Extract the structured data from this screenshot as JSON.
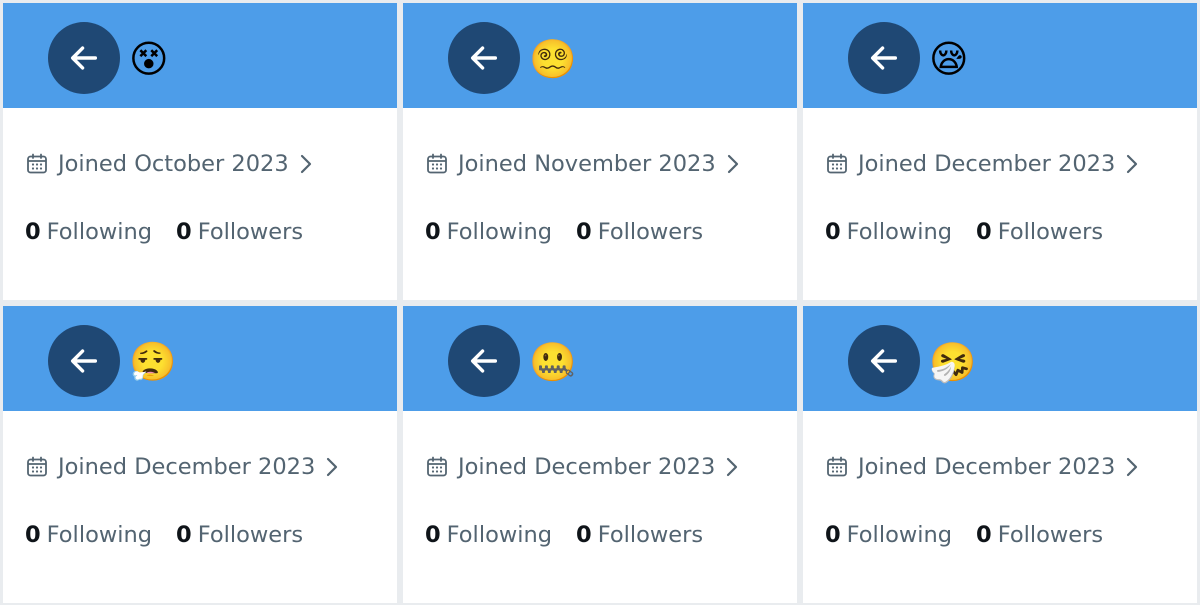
{
  "cards": [
    {
      "emoji": "😵",
      "joined": "Joined October 2023",
      "following_count": "0",
      "following_label": "Following",
      "followers_count": "0",
      "followers_label": "Followers"
    },
    {
      "emoji": "😵‍💫",
      "joined": "Joined November 2023",
      "following_count": "0",
      "following_label": "Following",
      "followers_count": "0",
      "followers_label": "Followers"
    },
    {
      "emoji": "😪",
      "joined": "Joined December 2023",
      "following_count": "0",
      "following_label": "Following",
      "followers_count": "0",
      "followers_label": "Followers"
    },
    {
      "emoji": "😮‍💨",
      "joined": "Joined December 2023",
      "following_count": "0",
      "following_label": "Following",
      "followers_count": "0",
      "followers_label": "Followers"
    },
    {
      "emoji": "🤐",
      "joined": "Joined December 2023",
      "following_count": "0",
      "following_label": "Following",
      "followers_count": "0",
      "followers_label": "Followers"
    },
    {
      "emoji": "🤧",
      "joined": "Joined December 2023",
      "following_count": "0",
      "following_label": "Following",
      "followers_count": "0",
      "followers_label": "Followers"
    }
  ],
  "icons": {
    "back": "arrow-left-icon",
    "joined": "calendar-icon",
    "more": "chevron-right-icon"
  },
  "colors": {
    "banner": "#4d9de9",
    "back_button": "#1f4874",
    "muted_text": "#536471",
    "count_text": "#0f1419"
  }
}
